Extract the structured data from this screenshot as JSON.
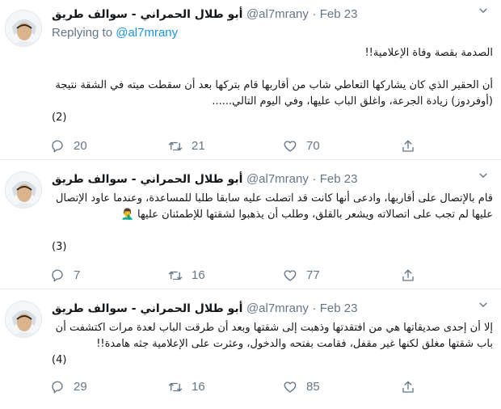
{
  "tweets": [
    {
      "name": "أبو طلال الحمراني - سوالف طريق",
      "handle": "@al7mrany",
      "separator": "·",
      "date": "Feb 23",
      "replying_prefix": "Replying to ",
      "replying_handle": "@al7mrany",
      "lines": [
        "الصدمة بقصة وفاة الإعلامية!!",
        "",
        "أن الحقير الذي كان يشاركها التعاطي شاب من أقاربها قام بتركها بعد أن سقطت ميته في الشقة نتيجة",
        "(أوفردوز) زيادة الجرعة، واغلق الباب عليها، وفي اليوم التالي......"
      ],
      "counter": "(2)",
      "replies": "20",
      "retweets": "21",
      "likes": "70"
    },
    {
      "name": "أبو طلال الحمراني - سوالف طريق",
      "handle": "@al7mrany",
      "separator": "·",
      "date": "Feb 23",
      "lines": [
        "قام بالإتصال على أقاربها، وادعى أنها كانت قد اتصلت عليه سابقا طلبا للمساعدة، وعندما عاود الإتصال",
        "عليها لم تجب على اتصالاته ويشعر بالقلق، وطلب أن يذهبوا لشقتها للإطمئنان عليها 🤦‍♂️"
      ],
      "counter": "(3)",
      "replies": "7",
      "retweets": "16",
      "likes": "77"
    },
    {
      "name": "أبو طلال الحمراني - سوالف طريق",
      "handle": "@al7mrany",
      "separator": "·",
      "date": "Feb 23",
      "lines": [
        "إلا أن إحدى صديقاتها هي من افتقدتها وذهبت إلى شقتها وبعد أن طرقت الباب لعدة مرات اكتشفت أن",
        "باب شقتها مغلق لكنها غير مقفل، فقامت بفتحه والدخول، وعثرت على الإعلامية جثه هامدة!!"
      ],
      "counter": "(4)",
      "replies": "29",
      "retweets": "16",
      "likes": "85"
    }
  ],
  "icons": {
    "reply": "reply-icon",
    "retweet": "retweet-icon",
    "like": "heart-icon",
    "share": "share-icon",
    "menu": "chevron-down-icon"
  },
  "colors": {
    "text": "#14171a",
    "secondary": "#657786",
    "link": "#1b95e0",
    "border": "#e6ecf0"
  }
}
